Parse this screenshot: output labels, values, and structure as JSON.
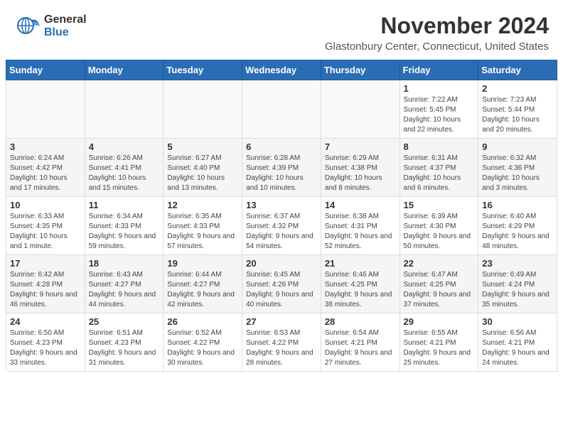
{
  "logo": {
    "general": "General",
    "blue": "Blue"
  },
  "title": "November 2024",
  "location": "Glastonbury Center, Connecticut, United States",
  "days_header": [
    "Sunday",
    "Monday",
    "Tuesday",
    "Wednesday",
    "Thursday",
    "Friday",
    "Saturday"
  ],
  "weeks": [
    [
      {
        "day": "",
        "info": ""
      },
      {
        "day": "",
        "info": ""
      },
      {
        "day": "",
        "info": ""
      },
      {
        "day": "",
        "info": ""
      },
      {
        "day": "",
        "info": ""
      },
      {
        "day": "1",
        "info": "Sunrise: 7:22 AM\nSunset: 5:45 PM\nDaylight: 10 hours and 22 minutes."
      },
      {
        "day": "2",
        "info": "Sunrise: 7:23 AM\nSunset: 5:44 PM\nDaylight: 10 hours and 20 minutes."
      }
    ],
    [
      {
        "day": "3",
        "info": "Sunrise: 6:24 AM\nSunset: 4:42 PM\nDaylight: 10 hours and 17 minutes."
      },
      {
        "day": "4",
        "info": "Sunrise: 6:26 AM\nSunset: 4:41 PM\nDaylight: 10 hours and 15 minutes."
      },
      {
        "day": "5",
        "info": "Sunrise: 6:27 AM\nSunset: 4:40 PM\nDaylight: 10 hours and 13 minutes."
      },
      {
        "day": "6",
        "info": "Sunrise: 6:28 AM\nSunset: 4:39 PM\nDaylight: 10 hours and 10 minutes."
      },
      {
        "day": "7",
        "info": "Sunrise: 6:29 AM\nSunset: 4:38 PM\nDaylight: 10 hours and 8 minutes."
      },
      {
        "day": "8",
        "info": "Sunrise: 6:31 AM\nSunset: 4:37 PM\nDaylight: 10 hours and 6 minutes."
      },
      {
        "day": "9",
        "info": "Sunrise: 6:32 AM\nSunset: 4:36 PM\nDaylight: 10 hours and 3 minutes."
      }
    ],
    [
      {
        "day": "10",
        "info": "Sunrise: 6:33 AM\nSunset: 4:35 PM\nDaylight: 10 hours and 1 minute."
      },
      {
        "day": "11",
        "info": "Sunrise: 6:34 AM\nSunset: 4:33 PM\nDaylight: 9 hours and 59 minutes."
      },
      {
        "day": "12",
        "info": "Sunrise: 6:35 AM\nSunset: 4:33 PM\nDaylight: 9 hours and 57 minutes."
      },
      {
        "day": "13",
        "info": "Sunrise: 6:37 AM\nSunset: 4:32 PM\nDaylight: 9 hours and 54 minutes."
      },
      {
        "day": "14",
        "info": "Sunrise: 6:38 AM\nSunset: 4:31 PM\nDaylight: 9 hours and 52 minutes."
      },
      {
        "day": "15",
        "info": "Sunrise: 6:39 AM\nSunset: 4:30 PM\nDaylight: 9 hours and 50 minutes."
      },
      {
        "day": "16",
        "info": "Sunrise: 6:40 AM\nSunset: 4:29 PM\nDaylight: 9 hours and 48 minutes."
      }
    ],
    [
      {
        "day": "17",
        "info": "Sunrise: 6:42 AM\nSunset: 4:28 PM\nDaylight: 9 hours and 46 minutes."
      },
      {
        "day": "18",
        "info": "Sunrise: 6:43 AM\nSunset: 4:27 PM\nDaylight: 9 hours and 44 minutes."
      },
      {
        "day": "19",
        "info": "Sunrise: 6:44 AM\nSunset: 4:27 PM\nDaylight: 9 hours and 42 minutes."
      },
      {
        "day": "20",
        "info": "Sunrise: 6:45 AM\nSunset: 4:26 PM\nDaylight: 9 hours and 40 minutes."
      },
      {
        "day": "21",
        "info": "Sunrise: 6:46 AM\nSunset: 4:25 PM\nDaylight: 9 hours and 38 minutes."
      },
      {
        "day": "22",
        "info": "Sunrise: 6:47 AM\nSunset: 4:25 PM\nDaylight: 9 hours and 37 minutes."
      },
      {
        "day": "23",
        "info": "Sunrise: 6:49 AM\nSunset: 4:24 PM\nDaylight: 9 hours and 35 minutes."
      }
    ],
    [
      {
        "day": "24",
        "info": "Sunrise: 6:50 AM\nSunset: 4:23 PM\nDaylight: 9 hours and 33 minutes."
      },
      {
        "day": "25",
        "info": "Sunrise: 6:51 AM\nSunset: 4:23 PM\nDaylight: 9 hours and 31 minutes."
      },
      {
        "day": "26",
        "info": "Sunrise: 6:52 AM\nSunset: 4:22 PM\nDaylight: 9 hours and 30 minutes."
      },
      {
        "day": "27",
        "info": "Sunrise: 6:53 AM\nSunset: 4:22 PM\nDaylight: 9 hours and 28 minutes."
      },
      {
        "day": "28",
        "info": "Sunrise: 6:54 AM\nSunset: 4:21 PM\nDaylight: 9 hours and 27 minutes."
      },
      {
        "day": "29",
        "info": "Sunrise: 6:55 AM\nSunset: 4:21 PM\nDaylight: 9 hours and 25 minutes."
      },
      {
        "day": "30",
        "info": "Sunrise: 6:56 AM\nSunset: 4:21 PM\nDaylight: 9 hours and 24 minutes."
      }
    ]
  ]
}
